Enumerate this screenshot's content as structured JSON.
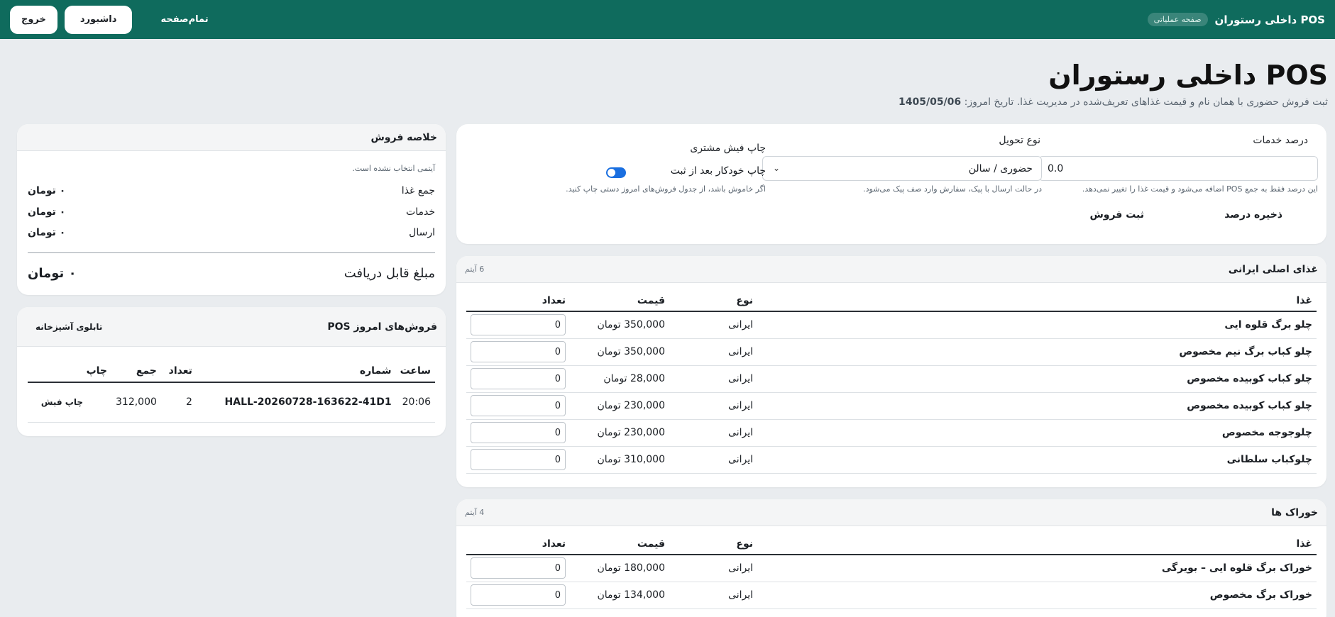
{
  "topbar": {
    "brand": "POS داخلی رستوران",
    "badge": "صفحه عملیاتی",
    "fullpage": "تمام‌صفحه",
    "dashboard": "داشبورد",
    "logout": "خروج"
  },
  "header": {
    "title": "POS داخلی رستوران",
    "subtitle": "ثبت فروش حضوری با همان نام و قیمت غذاهای تعریف‌شده در مدیریت غذا. تاریخ امروز:",
    "date": "1405/05/06"
  },
  "settings": {
    "service_label": "درصد خدمات",
    "service_value": "0.0",
    "service_hint": "این درصد فقط به جمع POS اضافه می‌شود و قیمت غذا را تغییر نمی‌دهد.",
    "delivery_label": "نوع تحویل",
    "delivery_value": "حضوری / سالن",
    "delivery_hint": "در حالت ارسال با پیک، سفارش وارد صف پیک می‌شود.",
    "print_label": "چاپ فیش مشتری",
    "autoprint_label": "چاپ خودکار بعد از ثبت",
    "autoprint_hint": "اگر خاموش باشد، از جدول فروش‌های امروز دستی چاپ کنید.",
    "save_percent": "ذخیره درصد",
    "submit_sale": "ثبت فروش"
  },
  "colors": {
    "topbar": "#0f6b5d",
    "toggle": "#1a6fe0"
  },
  "sections": [
    {
      "title": "غذای اصلی ایرانی",
      "count": "6 آیتم",
      "headers": [
        "غذا",
        "نوع",
        "قیمت",
        "تعداد"
      ],
      "rows": [
        {
          "food": "چلو برگ قلوه ایی",
          "type": "ایرانی",
          "price": "350,000 تومان",
          "qty": "0"
        },
        {
          "food": "چلو کباب برگ نیم مخصوص",
          "type": "ایرانی",
          "price": "350,000 تومان",
          "qty": "0"
        },
        {
          "food": "چلو کباب کوبیده مخصوص",
          "type": "ایرانی",
          "price": "28,000 تومان",
          "qty": "0"
        },
        {
          "food": "چلو کباب کوبیده مخصوص",
          "type": "ایرانی",
          "price": "230,000 تومان",
          "qty": "0"
        },
        {
          "food": "چلوجوجه مخصوص",
          "type": "ایرانی",
          "price": "230,000 تومان",
          "qty": "0"
        },
        {
          "food": "چلوکباب سلطانی",
          "type": "ایرانی",
          "price": "310,000 تومان",
          "qty": "0"
        }
      ]
    },
    {
      "title": "خوراک ها",
      "count": "4 آیتم",
      "headers": [
        "غذا",
        "نوع",
        "قیمت",
        "تعداد"
      ],
      "rows": [
        {
          "food": "خوراک برگ قلوه ایی – بویرگی",
          "type": "ایرانی",
          "price": "180,000 تومان",
          "qty": "0"
        },
        {
          "food": "خوراک برگ مخصوص",
          "type": "ایرانی",
          "price": "134,000 تومان",
          "qty": "0"
        }
      ]
    }
  ],
  "summary": {
    "title": "خلاصه فروش",
    "empty": "آیتمی انتخاب نشده است.",
    "food_total_label": "جمع غذا",
    "food_total": "۰ تومان",
    "service_label": "خدمات",
    "service": "۰ تومان",
    "shipping_label": "ارسال",
    "shipping": "۰ تومان",
    "payable_label": "مبلغ قابل دریافت",
    "payable": "۰ تومان"
  },
  "today_sales": {
    "title": "فروش‌های امروز POS",
    "kitchen_board": "تابلوی آشپزخانه",
    "headers": [
      "ساعت",
      "شماره",
      "تعداد",
      "جمع",
      "چاپ"
    ],
    "rows": [
      {
        "time": "20:06",
        "number": "HALL-20260728-163622-41D1",
        "count": "2",
        "total": "312,000",
        "print": "چاپ فیش"
      }
    ]
  }
}
